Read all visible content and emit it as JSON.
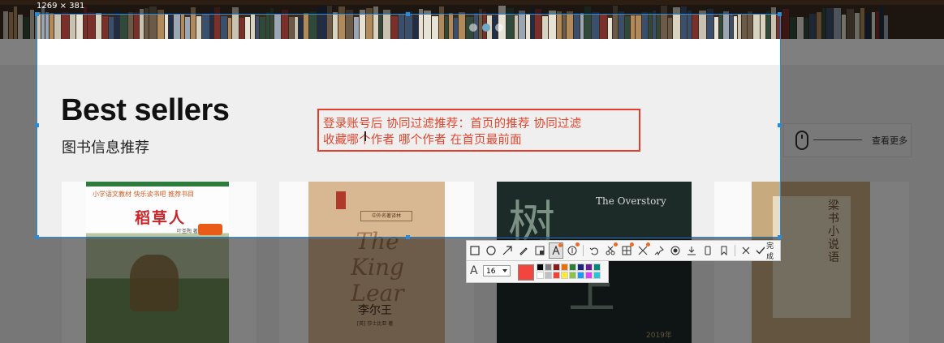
{
  "screenshot_tool": {
    "dimension_label": "1269 × 381",
    "annotation": {
      "line1": "登录账号后   协同过滤推荐：首页的推荐 协同过滤",
      "line2": "收藏哪个作者    哪个作者 在首页最前面"
    },
    "toolbar": {
      "tools": [
        {
          "name": "rectangle-tool",
          "icon": "□"
        },
        {
          "name": "ellipse-tool",
          "icon": "○"
        },
        {
          "name": "arrow-tool",
          "icon": "↗"
        },
        {
          "name": "pen-tool",
          "icon": "✎"
        },
        {
          "name": "mosaic-tool",
          "icon": "▣"
        },
        {
          "name": "text-tool",
          "icon": "A"
        },
        {
          "name": "number-tool",
          "icon": "①"
        }
      ],
      "actions": [
        {
          "name": "undo",
          "icon": "↶"
        },
        {
          "name": "translate",
          "icon": "⧉"
        },
        {
          "name": "ocr",
          "icon": "⊞"
        },
        {
          "name": "long-screenshot",
          "icon": "⤢"
        },
        {
          "name": "pin",
          "icon": "⚲"
        },
        {
          "name": "record",
          "icon": "◉"
        },
        {
          "name": "save",
          "icon": "⭳"
        },
        {
          "name": "phone",
          "icon": "▯"
        },
        {
          "name": "bookmark",
          "icon": "⚑"
        }
      ],
      "close_icon": "✕",
      "done_icon": "✓",
      "done_label": "完成"
    },
    "text_options": {
      "font_icon": "A",
      "font_size": "16",
      "current_color": "#f2453d",
      "palette": [
        "#000000",
        "#808080",
        "#8b1a1a",
        "#e8710a",
        "#2e7d32",
        "#1a237e",
        "#6a1b9a",
        "#00897b",
        "#ffffff",
        "#c0c0c0",
        "#f44336",
        "#ffeb3b",
        "#8bc34a",
        "#2196f3",
        "#e040fb",
        "#26c6da"
      ]
    }
  },
  "page": {
    "section_title": "Best sellers",
    "section_subtitle": "图书信息推荐",
    "view_more_label": "查看更多",
    "banner_dots": 3,
    "active_dot": 1,
    "books": [
      {
        "series": "小学语文教材  快乐读书吧  推荐书目",
        "title": "稻草人",
        "author": "叶圣陶 著"
      },
      {
        "series_strip": "中外名著译林",
        "title_en": "The King Lear",
        "title_cn": "李尔王",
        "author": "[英] 莎士比亚 著"
      },
      {
        "title_cn_top": "树",
        "title_cn_bottom": "上",
        "title_en": "The Overstory",
        "year": "2019年"
      },
      {
        "title_cn": "梁书小说语"
      }
    ]
  }
}
